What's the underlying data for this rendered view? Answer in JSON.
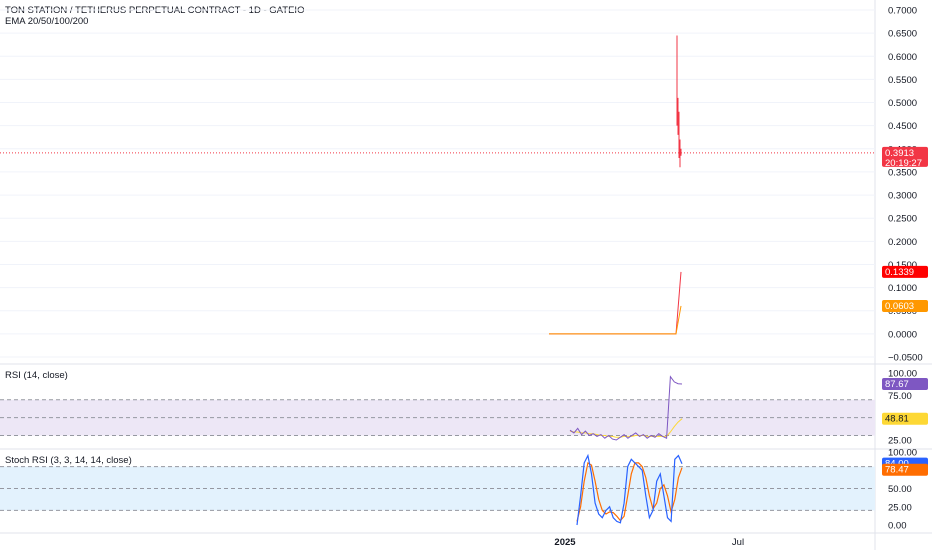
{
  "header": {
    "title": "TON STATION / TETHERUS PERPETUAL CONTRACT - 1D - GATEIO",
    "indicator": "EMA 20/50/100/200"
  },
  "rsi_panel": {
    "label": "RSI (14, close)"
  },
  "stoch_panel": {
    "label": "Stoch RSI (3, 3, 14, 14, close)"
  },
  "colors": {
    "candle_down": "#f23645",
    "ema_orange": "#ff9800",
    "rsi_line": "#7e57c2",
    "rsi_ma": "#fdd835",
    "rsi_band": "#ede7f6",
    "stoch_k": "#2962ff",
    "stoch_d": "#ff6d00",
    "stoch_band": "#e3f2fd",
    "price_badge": "#f23645",
    "ema_badge_red": "#ff0000",
    "ema_badge_orange": "#ff9800"
  },
  "chart_data": [
    {
      "type": "line",
      "title": "TON STATION / TETHERUS PERPETUAL CONTRACT - 1D - GATEIO",
      "ylim": [
        -0.05,
        0.7
      ],
      "y_ticks": [
        "0.7000",
        "0.6500",
        "0.6000",
        "0.5500",
        "0.5000",
        "0.4500",
        "0.4000",
        "0.3500",
        "0.3000",
        "0.2500",
        "0.2000",
        "0.1500",
        "0.1000",
        "0.0500",
        "0.0000",
        "−0.0500"
      ],
      "x_labels": [
        "2025",
        "Jul"
      ],
      "last_price": 0.3913,
      "last_price_label": "0.3913",
      "countdown": "20:19:27",
      "series": [
        {
          "name": "EMA 20",
          "last": 0.1339,
          "last_label": "0.1339"
        },
        {
          "name": "EMA 50",
          "last": 0.0603,
          "last_label": "0.0603"
        }
      ],
      "candles": {
        "high": 0.645,
        "low": 0.36,
        "close": 0.3913
      }
    },
    {
      "type": "line",
      "title": "RSI (14, close)",
      "ylim": [
        25,
        100
      ],
      "y_ticks": [
        "100.00",
        "75.00",
        "25.00"
      ],
      "bands": [
        70,
        50,
        30
      ],
      "series": [
        {
          "name": "RSI",
          "last": 87.67,
          "last_label": "87.67",
          "values": [
            36,
            33,
            38,
            31,
            35,
            30,
            32,
            29,
            31,
            27,
            30,
            26,
            25,
            28,
            31,
            27,
            30,
            33,
            29,
            31,
            27,
            30,
            28,
            32,
            29,
            27,
            96,
            90,
            88,
            87.67
          ]
        },
        {
          "name": "RSI MA",
          "last": 48.81,
          "last_label": "48.81",
          "values": [
            35,
            34,
            34,
            33,
            33,
            32,
            32,
            31,
            30,
            30,
            29,
            29,
            28,
            28,
            29,
            29,
            29,
            30,
            30,
            30,
            29,
            29,
            29,
            29,
            29,
            29,
            34,
            40,
            45,
            48.81
          ]
        }
      ]
    },
    {
      "type": "line",
      "title": "Stoch RSI (3, 3, 14, 14, close)",
      "ylim": [
        0,
        100
      ],
      "y_ticks": [
        "100.00",
        "50.00",
        "25.00",
        "0.00"
      ],
      "bands": [
        80,
        50,
        20
      ],
      "series": [
        {
          "name": "K",
          "last": 84.0,
          "last_label": "84.00",
          "values": [
            0,
            40,
            85,
            95,
            70,
            30,
            15,
            10,
            20,
            25,
            10,
            5,
            3,
            30,
            80,
            90,
            85,
            80,
            75,
            40,
            10,
            20,
            60,
            70,
            40,
            10,
            5,
            90,
            95,
            84
          ]
        },
        {
          "name": "D",
          "last": 78.47,
          "last_label": "78.47",
          "values": [
            5,
            25,
            60,
            85,
            82,
            60,
            35,
            20,
            15,
            18,
            17,
            12,
            6,
            12,
            40,
            70,
            85,
            85,
            80,
            65,
            40,
            22,
            30,
            50,
            55,
            40,
            18,
            35,
            65,
            78.47
          ]
        }
      ]
    }
  ]
}
